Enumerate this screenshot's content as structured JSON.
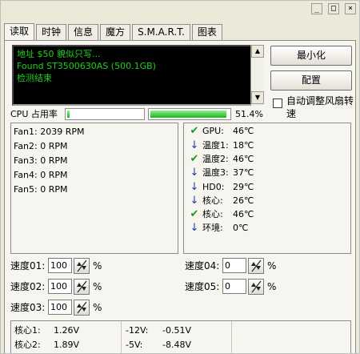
{
  "title_controls": {
    "minimize": "_",
    "maximize": "□",
    "close": "×"
  },
  "tabs": [
    {
      "label": "读取",
      "active": true
    },
    {
      "label": "时钟"
    },
    {
      "label": "信息"
    },
    {
      "label": "魔方"
    },
    {
      "label": "S.M.A.R.T."
    },
    {
      "label": "图表"
    }
  ],
  "console": {
    "lines": [
      "地址 $50 貌似只写...",
      "Found ST3500630AS (500.1GB)",
      "检测结束"
    ]
  },
  "buttons": {
    "minimize": "最小化",
    "config": "配置"
  },
  "auto_fan_label": "自动调整风扇转速",
  "cpu": {
    "label": "CPU 占用率",
    "percent_text": "51.4%",
    "bar_left_level": 0.03,
    "bar_right_level": 0.97
  },
  "fans": [
    {
      "label": "Fan1:",
      "value": "2039 RPM"
    },
    {
      "label": "Fan2:",
      "value": "0 RPM"
    },
    {
      "label": "Fan3:",
      "value": "0 RPM"
    },
    {
      "label": "Fan4:",
      "value": "0 RPM"
    },
    {
      "label": "Fan5:",
      "value": "0 RPM"
    }
  ],
  "temps": [
    {
      "icon": "check-icon",
      "label": "GPU:",
      "value": "46℃"
    },
    {
      "icon": "down-arrow-icon",
      "label": "温度1:",
      "value": "18℃"
    },
    {
      "icon": "check-icon",
      "label": "温度2:",
      "value": "46℃"
    },
    {
      "icon": "down-arrow-icon",
      "label": "温度3:",
      "value": "37℃"
    },
    {
      "icon": "down-arrow-icon",
      "label": "HD0:",
      "value": "29℃"
    },
    {
      "icon": "down-arrow-icon",
      "label": "核心:",
      "value": "26℃"
    },
    {
      "icon": "check-icon",
      "label": "核心:",
      "value": "46℃"
    },
    {
      "icon": "down-arrow-icon",
      "label": "环境:",
      "value": "0℃"
    }
  ],
  "speeds": [
    {
      "label": "速度01:",
      "value": "100",
      "unit": "%"
    },
    {
      "label": "速度02:",
      "value": "100",
      "unit": "%"
    },
    {
      "label": "速度03:",
      "value": "100",
      "unit": "%"
    },
    {
      "label": "速度04:",
      "value": "0",
      "unit": "%"
    },
    {
      "label": "速度05:",
      "value": "0",
      "unit": "%"
    }
  ],
  "voltages": [
    {
      "label": "核心1:",
      "value": "1.26V"
    },
    {
      "label": "核心2:",
      "value": "1.89V"
    },
    {
      "label": "-12V:",
      "value": "-0.51V"
    },
    {
      "label": "-5V:",
      "value": "-8.48V"
    }
  ],
  "colors": {
    "console_text": "#1fd11f",
    "check": "#179a17",
    "arrow": "#1a3da8",
    "bar_fill": "#1bb51b"
  }
}
